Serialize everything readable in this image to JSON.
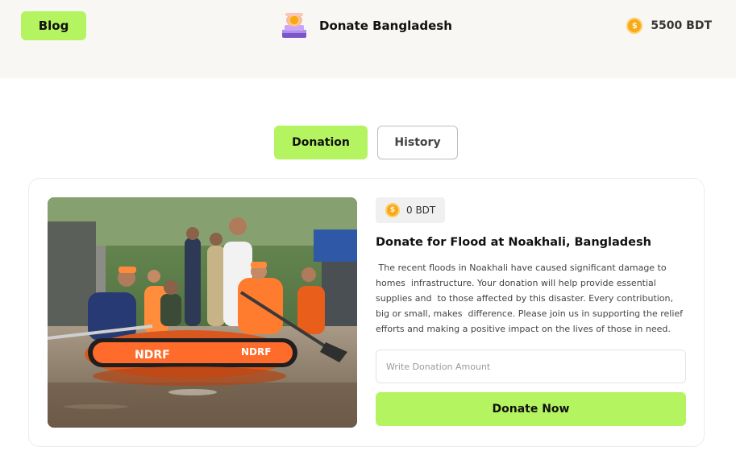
{
  "header": {
    "blog_label": "Blog",
    "brand_name": "Donate Bangladesh",
    "balance": "5500 BDT",
    "balance_icon": "coin-icon",
    "brand_icon": "donation-box-icon"
  },
  "tabs": [
    {
      "label": "Donation",
      "active": true
    },
    {
      "label": "History",
      "active": false
    }
  ],
  "campaign": {
    "raised": "0 BDT",
    "title": "Donate for Flood at Noakhali, Bangladesh",
    "description": " The recent floods in Noakhali have caused significant damage to homes  infrastructure. Your donation will help provide essential supplies and  to those affected by this disaster. Every contribution, big or small, makes  difference. Please join us in supporting the relief efforts and making a positive impact on the lives of those in need.",
    "amount_placeholder": "Write Donation Amount",
    "amount_value": "",
    "donate_label": "Donate Now",
    "boat_text": "NDRF",
    "image_subject": "flood-rescue-boat-photo"
  },
  "colors": {
    "accent": "#b4f461",
    "header_bg": "#f8f7f4",
    "coin": "#f7a91b"
  }
}
